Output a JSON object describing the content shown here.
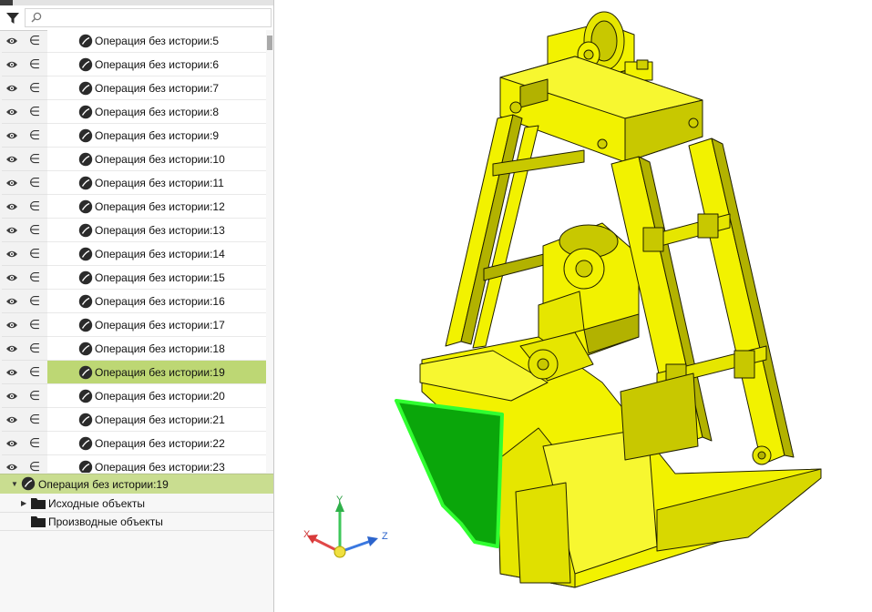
{
  "search": {
    "placeholder": ""
  },
  "tree": {
    "items": [
      {
        "label": "Операция без истории:5"
      },
      {
        "label": "Операция без истории:6"
      },
      {
        "label": "Операция без истории:7"
      },
      {
        "label": "Операция без истории:8"
      },
      {
        "label": "Операция без истории:9"
      },
      {
        "label": "Операция без истории:10"
      },
      {
        "label": "Операция без истории:11"
      },
      {
        "label": "Операция без истории:12"
      },
      {
        "label": "Операция без истории:13"
      },
      {
        "label": "Операция без истории:14"
      },
      {
        "label": "Операция без истории:15"
      },
      {
        "label": "Операция без истории:16"
      },
      {
        "label": "Операция без истории:17"
      },
      {
        "label": "Операция без истории:18"
      },
      {
        "label": "Операция без истории:19",
        "selected": true
      },
      {
        "label": "Операция без истории:20"
      },
      {
        "label": "Операция без истории:21"
      },
      {
        "label": "Операция без истории:22"
      },
      {
        "label": "Операция без истории:23"
      }
    ],
    "include_symbol": "∈"
  },
  "detail": {
    "title": "Операция без истории:19",
    "source_objects": "Исходные объекты",
    "derived_objects": "Производные объекты"
  },
  "triad": {
    "x": "X",
    "y": "Y",
    "z": "Z"
  },
  "colors": {
    "selection": "#bdd774",
    "model_yellow": "#f2f200",
    "model_shade": "#b2b200",
    "highlight_green": "#0aa60a",
    "highlight_edge": "#30ff30"
  },
  "icons": [
    "filter-icon",
    "search-icon",
    "eye-icon",
    "operation-icon",
    "folder-icon"
  ]
}
